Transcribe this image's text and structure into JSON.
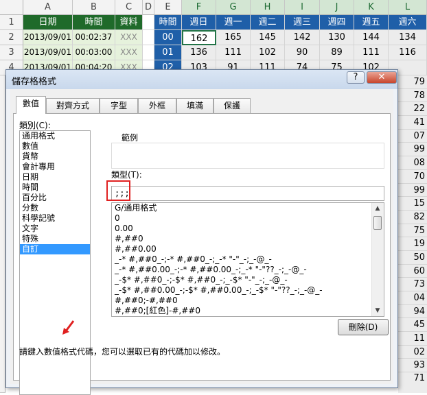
{
  "sheet": {
    "columns": [
      "A",
      "B",
      "C",
      "D",
      "E",
      "F",
      "G",
      "H",
      "I",
      "J",
      "K",
      "L"
    ],
    "rows": [
      "1",
      "2",
      "3",
      "4"
    ],
    "headers": [
      "日期",
      "時間",
      "資料",
      "時間",
      "週日",
      "週一",
      "週二",
      "週三",
      "週四",
      "週五",
      "週六"
    ],
    "data_rows": [
      {
        "date": "2013/09/01",
        "time": "00:02:37",
        "data": "XXX",
        "hour": "00",
        "values": [
          "162",
          "165",
          "145",
          "142",
          "130",
          "144",
          "134"
        ]
      },
      {
        "date": "2013/09/01",
        "time": "00:03:00",
        "data": "XXX",
        "hour": "01",
        "values": [
          "136",
          "111",
          "102",
          "90",
          "89",
          "111",
          "116"
        ]
      },
      {
        "date": "2013/09/01",
        "time": "00:04:20",
        "data": "XXX",
        "hour": "02",
        "values": [
          "103",
          "91",
          "111",
          "74",
          "75",
          "102",
          ""
        ]
      }
    ],
    "right_edge_values": [
      "79",
      "78",
      "22",
      "41",
      "07",
      "99",
      "08",
      "70",
      "99",
      "15",
      "82",
      "75",
      "19",
      "50",
      "60",
      "73",
      "04",
      "94",
      "45",
      "11",
      "02",
      "93"
    ],
    "last_value": "71"
  },
  "dialog": {
    "title": "儲存格格式",
    "help": "?",
    "close": "✕",
    "tabs": [
      "數值",
      "對齊方式",
      "字型",
      "外框",
      "填滿",
      "保護"
    ],
    "category_label": "類別(C):",
    "categories": [
      "通用格式",
      "數值",
      "貨幣",
      "會計專用",
      "日期",
      "時間",
      "百分比",
      "分數",
      "科學記號",
      "文字",
      "特殊",
      "自訂"
    ],
    "selected_category": "自訂",
    "sample_label": "範例",
    "type_label": "類型(T):",
    "type_value": ";;;",
    "formats": [
      "G/通用格式",
      "0",
      "0.00",
      "#,##0",
      "#,##0.00",
      "_-* #,##0_-;-* #,##0_-;_-* \"-\"_-;_-@_-",
      "_-* #,##0.00_-;-* #,##0.00_-;_-* \"-\"??_-;_-@_-",
      "_-$* #,##0_-;-$* #,##0_-;_-$* \"-\"_-;_-@_-",
      "_-$* #,##0.00_-;-$* #,##0.00_-;_-$* \"-\"??_-;_-@_-",
      "#,##0;-#,##0",
      "#,##0;[紅色]-#,##0"
    ],
    "delete_button": "刪除(D)",
    "hint": "請鍵入數值格式代碼，您可以選取已有的代碼加以修改。"
  },
  "colors": {
    "header_green": "#1f6a2a",
    "header_blue": "#1f5fa8",
    "accent_red": "#e02020",
    "selection_blue": "#3399ff"
  },
  "icons": {
    "arrow": "red-arrow-icon",
    "scroll_up": "scroll-up-icon",
    "scroll_down": "scroll-down-icon"
  }
}
